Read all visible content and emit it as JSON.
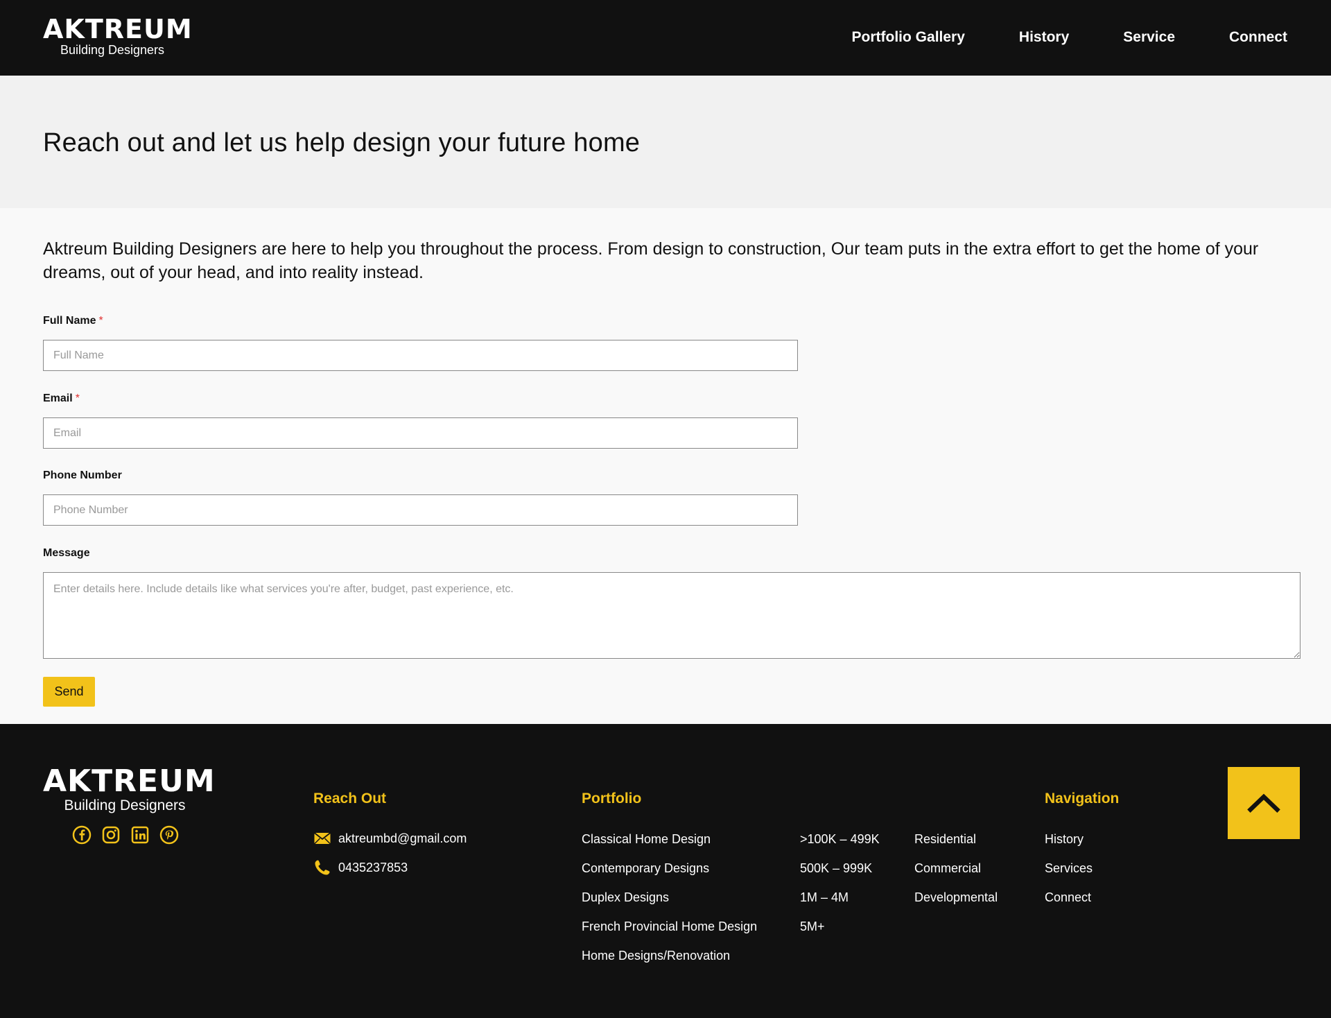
{
  "brand": {
    "name": "AKTREUM",
    "tagline": "Building Designers"
  },
  "nav": [
    {
      "label": "Portfolio Gallery"
    },
    {
      "label": "History"
    },
    {
      "label": "Service"
    },
    {
      "label": "Connect"
    }
  ],
  "hero": {
    "title": "Reach out and let us help design your future home"
  },
  "intro": "Aktreum Building Designers are here to help you throughout the process. From design to construction, Our team puts in the extra effort to get the home of your dreams, out of your head, and into reality instead.",
  "form": {
    "full_name": {
      "label": "Full Name",
      "required": "*",
      "placeholder": "Full Name",
      "value": ""
    },
    "email": {
      "label": "Email",
      "required": "*",
      "placeholder": "Email",
      "value": ""
    },
    "phone": {
      "label": "Phone Number",
      "placeholder": "Phone Number",
      "value": ""
    },
    "message": {
      "label": "Message",
      "placeholder": "Enter details here. Include details like what services you're after, budget, past experience, etc.",
      "value": ""
    },
    "send_label": "Send"
  },
  "footer": {
    "reach_out": {
      "title": "Reach Out",
      "email": "aktreumbd@gmail.com",
      "phone": "0435237853"
    },
    "portfolio": {
      "title": "Portfolio",
      "designs": [
        "Classical Home Design",
        "Contemporary Designs",
        "Duplex Designs",
        "French Provincial Home Design",
        "Home Designs/Renovation"
      ],
      "budgets": [
        ">100K – 499K",
        "500K – 999K",
        "1M – 4M",
        "5M+"
      ],
      "types": [
        "Residential",
        "Commercial",
        "Developmental"
      ]
    },
    "navigation": {
      "title": "Navigation",
      "items": [
        "History",
        "Services",
        "Connect"
      ]
    },
    "socials": [
      "facebook-icon",
      "instagram-icon",
      "linkedin-icon",
      "pinterest-icon"
    ]
  },
  "colors": {
    "accent": "#f2c21a",
    "dark": "#111111",
    "hero_bg": "#f1f1f1",
    "page_bg": "#f9f9f9"
  }
}
